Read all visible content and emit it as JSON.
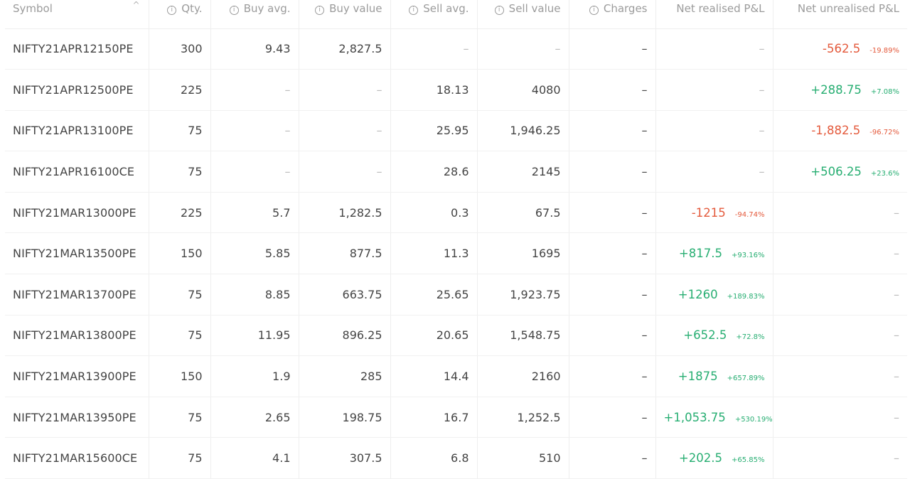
{
  "columns": [
    {
      "label": "Symbol",
      "info": false,
      "sortable": true
    },
    {
      "label": "Qty.",
      "info": true
    },
    {
      "label": "Buy avg.",
      "info": true
    },
    {
      "label": "Buy value",
      "info": true
    },
    {
      "label": "Sell avg.",
      "info": true
    },
    {
      "label": "Sell value",
      "info": true
    },
    {
      "label": "Charges",
      "info": true
    },
    {
      "label": "Net realised P&L",
      "info": false
    },
    {
      "label": "Net unrealised P&L",
      "info": false
    }
  ],
  "empty": "–",
  "colors": {
    "positive": "#27ae72",
    "negative": "#e45a3c"
  },
  "rows": [
    {
      "symbol": "NIFTY21APR12150PE",
      "qty": "300",
      "buy_avg": "9.43",
      "buy_value": "2,827.5",
      "sell_avg": "–",
      "sell_value": "–",
      "charges": "–",
      "realised": null,
      "unrealised": {
        "value": "-562.5",
        "pct": "-19.89%",
        "sign": "neg"
      }
    },
    {
      "symbol": "NIFTY21APR12500PE",
      "qty": "225",
      "buy_avg": "–",
      "buy_value": "–",
      "sell_avg": "18.13",
      "sell_value": "4080",
      "charges": "–",
      "realised": null,
      "unrealised": {
        "value": "+288.75",
        "pct": "+7.08%",
        "sign": "pos"
      }
    },
    {
      "symbol": "NIFTY21APR13100PE",
      "qty": "75",
      "buy_avg": "–",
      "buy_value": "–",
      "sell_avg": "25.95",
      "sell_value": "1,946.25",
      "charges": "–",
      "realised": null,
      "unrealised": {
        "value": "-1,882.5",
        "pct": "-96.72%",
        "sign": "neg"
      }
    },
    {
      "symbol": "NIFTY21APR16100CE",
      "qty": "75",
      "buy_avg": "–",
      "buy_value": "–",
      "sell_avg": "28.6",
      "sell_value": "2145",
      "charges": "–",
      "realised": null,
      "unrealised": {
        "value": "+506.25",
        "pct": "+23.6%",
        "sign": "pos"
      }
    },
    {
      "symbol": "NIFTY21MAR13000PE",
      "qty": "225",
      "buy_avg": "5.7",
      "buy_value": "1,282.5",
      "sell_avg": "0.3",
      "sell_value": "67.5",
      "charges": "–",
      "realised": {
        "value": "-1215",
        "pct": "-94.74%",
        "sign": "neg"
      },
      "unrealised": null
    },
    {
      "symbol": "NIFTY21MAR13500PE",
      "qty": "150",
      "buy_avg": "5.85",
      "buy_value": "877.5",
      "sell_avg": "11.3",
      "sell_value": "1695",
      "charges": "–",
      "realised": {
        "value": "+817.5",
        "pct": "+93.16%",
        "sign": "pos"
      },
      "unrealised": null
    },
    {
      "symbol": "NIFTY21MAR13700PE",
      "qty": "75",
      "buy_avg": "8.85",
      "buy_value": "663.75",
      "sell_avg": "25.65",
      "sell_value": "1,923.75",
      "charges": "–",
      "realised": {
        "value": "+1260",
        "pct": "+189.83%",
        "sign": "pos"
      },
      "unrealised": null
    },
    {
      "symbol": "NIFTY21MAR13800PE",
      "qty": "75",
      "buy_avg": "11.95",
      "buy_value": "896.25",
      "sell_avg": "20.65",
      "sell_value": "1,548.75",
      "charges": "–",
      "realised": {
        "value": "+652.5",
        "pct": "+72.8%",
        "sign": "pos"
      },
      "unrealised": null
    },
    {
      "symbol": "NIFTY21MAR13900PE",
      "qty": "150",
      "buy_avg": "1.9",
      "buy_value": "285",
      "sell_avg": "14.4",
      "sell_value": "2160",
      "charges": "–",
      "realised": {
        "value": "+1875",
        "pct": "+657.89%",
        "sign": "pos"
      },
      "unrealised": null
    },
    {
      "symbol": "NIFTY21MAR13950PE",
      "qty": "75",
      "buy_avg": "2.65",
      "buy_value": "198.75",
      "sell_avg": "16.7",
      "sell_value": "1,252.5",
      "charges": "–",
      "realised": {
        "value": "+1,053.75",
        "pct": "+530.19%",
        "sign": "pos"
      },
      "unrealised": null
    },
    {
      "symbol": "NIFTY21MAR15600CE",
      "qty": "75",
      "buy_avg": "4.1",
      "buy_value": "307.5",
      "sell_avg": "6.8",
      "sell_value": "510",
      "charges": "–",
      "realised": {
        "value": "+202.5",
        "pct": "+65.85%",
        "sign": "pos"
      },
      "unrealised": null
    }
  ]
}
